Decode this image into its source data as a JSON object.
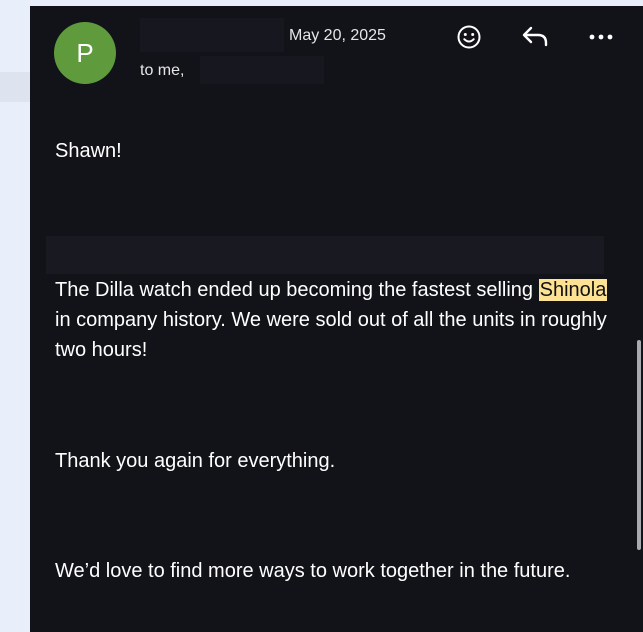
{
  "email": {
    "avatar_letter": "P",
    "to_label": "to me,",
    "date": "May 20, 2025",
    "avatar_color": "#5f9b3c",
    "background_color": "#121319",
    "highlight_color": "#fde293"
  },
  "actions": {
    "emoji_icon": "emoji-reaction-icon",
    "reply_icon": "reply-icon",
    "more_icon": "more-options-icon"
  },
  "body": {
    "greeting": "Shawn!",
    "paragraph1_before": "The Dilla watch ended up becoming the fastest selling ",
    "paragraph1_highlight": "Shinola",
    "paragraph1_after": " in company history. We were sold out of all the units in roughly two hours!",
    "paragraph2": "Thank you again for everything.",
    "paragraph3": "We’d love to find more ways to work together in the future."
  }
}
